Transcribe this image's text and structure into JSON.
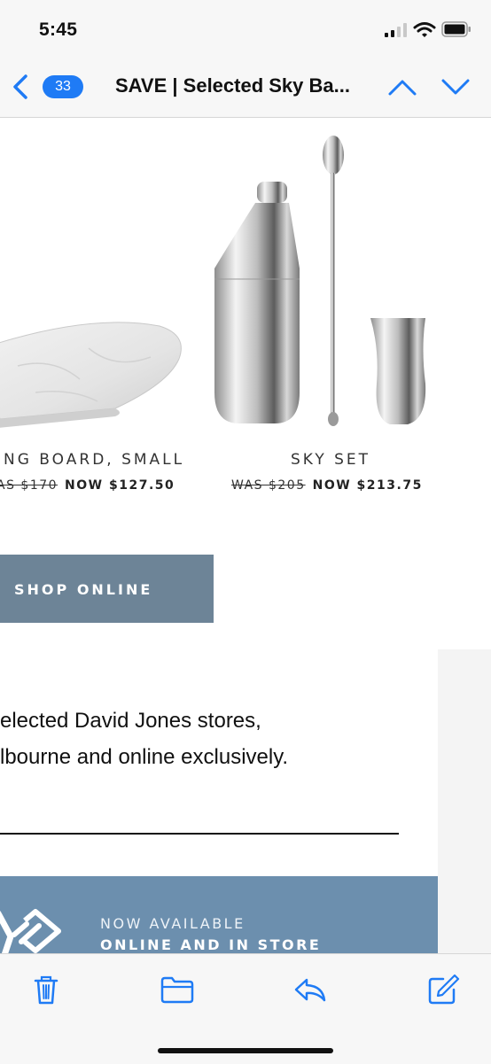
{
  "status_bar": {
    "time": "5:45"
  },
  "nav": {
    "back_count": "33",
    "title": "SAVE | Selected Sky Ba..."
  },
  "products": [
    {
      "name": "ING BOARD, SMALL",
      "was": "AS $170",
      "now": "NOW $127.50"
    },
    {
      "name": "SKY SET",
      "was": "WAS $205",
      "now": "NOW $213.75"
    }
  ],
  "shop_button": {
    "label": "SHOP ONLINE"
  },
  "body_text": {
    "line1": "elected David Jones stores,",
    "line2": "lbourne and online exclusively."
  },
  "banner": {
    "line1": "NOW AVAILABLE",
    "line2": "ONLINE AND IN STORE"
  },
  "colors": {
    "accent_blue": "#1f7bf5",
    "button_slate": "#6d8497",
    "banner_blue": "#6c8fae"
  },
  "toolbar": {
    "icons": [
      "trash-icon",
      "folder-icon",
      "reply-icon",
      "compose-icon"
    ]
  }
}
